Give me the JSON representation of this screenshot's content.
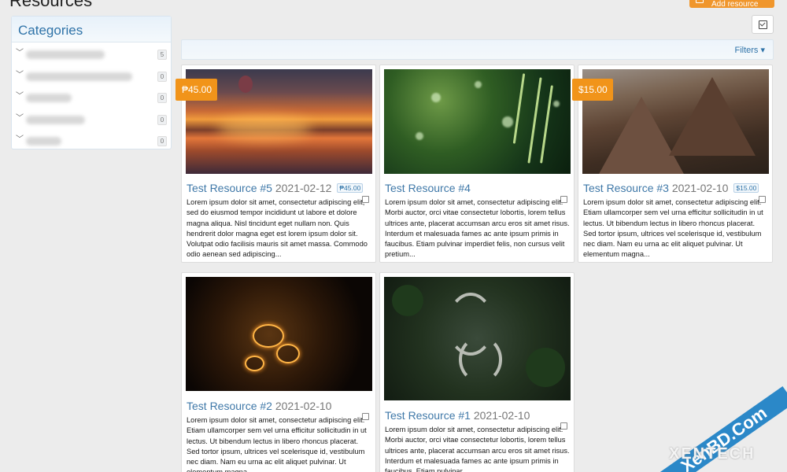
{
  "page": {
    "title": "Resources",
    "add_button": "Add resource"
  },
  "sidebar": {
    "title": "Categories",
    "items": [
      {
        "count": "5"
      },
      {
        "count": "0"
      },
      {
        "count": "0"
      },
      {
        "count": "0"
      },
      {
        "count": "0"
      }
    ]
  },
  "toolbar": {
    "filters_label": "Filters ▾"
  },
  "resources": [
    {
      "title": "Test Resource #5",
      "date": "2021-02-12",
      "price_badge": "₱45.00",
      "price_tag": "₱45.00",
      "description": "Lorem ipsum dolor sit amet, consectetur adipiscing elit, sed do eiusmod tempor incididunt ut labore et dolore magna aliqua. Nisl tincidunt eget nullam non. Quis hendrerit dolor magna eget est lorem ipsum dolor sit. Volutpat odio facilisis mauris sit amet massa. Commodo odio aenean sed adipiscing..."
    },
    {
      "title": "Test Resource #4",
      "date": "",
      "price_badge": "",
      "price_tag": "",
      "description": "Lorem ipsum dolor sit amet, consectetur adipiscing elit. Morbi auctor, orci vitae consectetur lobortis, lorem tellus ultrices ante, placerat accumsan arcu eros sit amet risus. Interdum et malesuada fames ac ante ipsum primis in faucibus. Etiam pulvinar imperdiet felis, non cursus velit pretium..."
    },
    {
      "title": "Test Resource #3",
      "date": "2021-02-10",
      "price_badge": "$15.00",
      "price_tag": "$15.00",
      "description": "Lorem ipsum dolor sit amet, consectetur adipiscing elit. Etiam ullamcorper sem vel urna efficitur sollicitudin in ut lectus. Ut bibendum lectus in libero rhoncus placerat. Sed tortor ipsum, ultrices vel scelerisque id, vestibulum nec diam. Nam eu urna ac elit aliquet pulvinar. Ut elementum magna..."
    },
    {
      "title": "Test Resource #2",
      "date": "2021-02-10",
      "price_badge": "",
      "price_tag": "",
      "description": "Lorem ipsum dolor sit amet, consectetur adipiscing elit. Etiam ullamcorper sem vel urna efficitur sollicitudin in ut lectus. Ut bibendum lectus in libero rhoncus placerat. Sed tortor ipsum, ultrices vel scelerisque id, vestibulum nec diam. Nam eu urna ac elit aliquet pulvinar. Ut elementum magna..."
    },
    {
      "title": "Test Resource #1",
      "date": "2021-02-10",
      "price_badge": "",
      "price_tag": "",
      "description": "Lorem ipsum dolor sit amet, consectetur adipiscing elit. Morbi auctor, orci vitae consectetur lobortis, lorem tellus ultrices ante, placerat accumsan arcu eros sit amet risus. Interdum et malesuada fames ac ante ipsum primis in faucibus. Etiam pulvinar..."
    }
  ],
  "watermark": {
    "domain": "XenBD.Com",
    "brand": "XENTECH"
  }
}
